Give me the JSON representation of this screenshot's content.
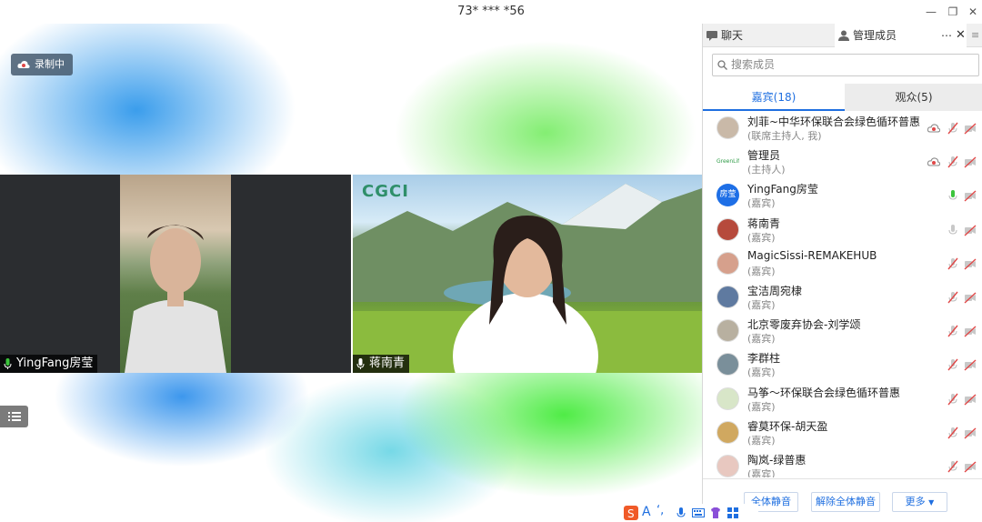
{
  "window": {
    "title": "73* *** *56"
  },
  "stage": {
    "recording_label": "录制中",
    "left_video": {
      "name": "YingFang房莹"
    },
    "right_video": {
      "name": "蒋南青",
      "logo_text": "CGCI"
    }
  },
  "panel": {
    "tabs": [
      {
        "label": "聊天"
      },
      {
        "label": "管理成员"
      }
    ],
    "search_placeholder": "搜索成员",
    "subtabs": [
      {
        "label": "嘉宾(18)"
      },
      {
        "label": "观众(5)"
      }
    ],
    "members": [
      {
        "name": "刘菲~中华环保联合会绿色循环普惠",
        "role": "(联席主持人, 我)",
        "avatar_color": "#c9b9a8",
        "avatar_text": ""
      },
      {
        "name": "管理员",
        "role": "(主持人)",
        "avatar_color": "#ffffff",
        "avatar_text": "GreenLife"
      },
      {
        "name": "YingFang房莹",
        "role": "(嘉宾)",
        "avatar_color": "#1e6fe6",
        "avatar_text": "房莹"
      },
      {
        "name": "蒋南青",
        "role": "(嘉宾)",
        "avatar_color": "#b64a3c",
        "avatar_text": ""
      },
      {
        "name": "MagicSissi-REMAKEHUB",
        "role": "(嘉宾)",
        "avatar_color": "#d6a08c",
        "avatar_text": ""
      },
      {
        "name": "宝洁周宛棣",
        "role": "(嘉宾)",
        "avatar_color": "#5f7aa0",
        "avatar_text": ""
      },
      {
        "name": "北京零废弃协会-刘学颂",
        "role": "(嘉宾)",
        "avatar_color": "#b8b0a0",
        "avatar_text": ""
      },
      {
        "name": "李群柱",
        "role": "(嘉宾)",
        "avatar_color": "#7a8f9a",
        "avatar_text": ""
      },
      {
        "name": "马筝～环保联合会绿色循环普惠",
        "role": "(嘉宾)",
        "avatar_color": "#d8e6c8",
        "avatar_text": ""
      },
      {
        "name": "睿莫环保-胡天盈",
        "role": "(嘉宾)",
        "avatar_color": "#d0a860",
        "avatar_text": ""
      },
      {
        "name": "陶岚-绿普惠",
        "role": "(嘉宾)",
        "avatar_color": "#e8c8c0",
        "avatar_text": ""
      }
    ],
    "footer": {
      "mute_all": "全体静音",
      "unmute_all": "解除全体静音",
      "more": "更多"
    }
  },
  "ime": {
    "label": "A"
  },
  "colors": {
    "accent": "#1f6fe0",
    "mute_red": "#e04848",
    "mic_green": "#3cc43c"
  }
}
